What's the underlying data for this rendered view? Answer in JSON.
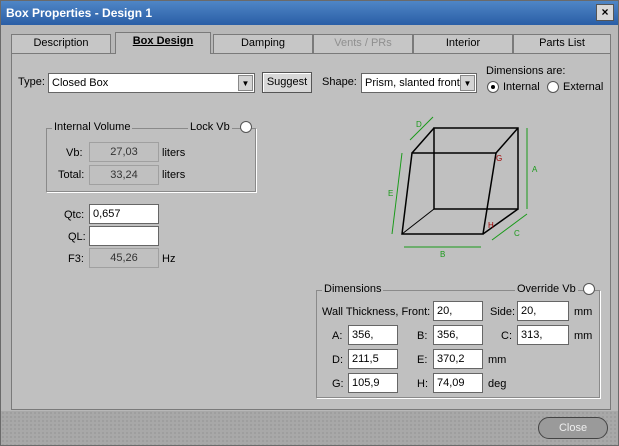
{
  "window": {
    "title": "Box Properties - Design 1"
  },
  "tabs": [
    {
      "label": "Description"
    },
    {
      "label": "Box Design"
    },
    {
      "label": "Damping"
    },
    {
      "label": "Vents / PRs"
    },
    {
      "label": "Interior"
    },
    {
      "label": "Parts List"
    }
  ],
  "type": {
    "label": "Type:",
    "value": "Closed Box",
    "suggest": "Suggest"
  },
  "shape": {
    "label": "Shape:",
    "value": "Prism, slanted front"
  },
  "dims_are": {
    "label": "Dimensions are:",
    "internal": "Internal",
    "external": "External",
    "selected": "Internal"
  },
  "internal_volume": {
    "title": "Internal Volume",
    "lock": "Lock Vb",
    "vb_label": "Vb:",
    "vb": "27,03",
    "vb_unit": "liters",
    "total_label": "Total:",
    "total": "33,24",
    "total_unit": "liters"
  },
  "params": {
    "qtc_label": "Qtc:",
    "qtc": "0,657",
    "ql_label": "QL:",
    "ql": "",
    "f3_label": "F3:",
    "f3": "45,26",
    "f3_unit": "Hz"
  },
  "diagram": {
    "labels": [
      "D",
      "A",
      "E",
      "G",
      "H",
      "C",
      "B"
    ],
    "accent": "#1a9a1a",
    "marker": "#a00000"
  },
  "dimensions": {
    "title": "Dimensions",
    "override": "Override Vb",
    "wall_label": "Wall Thickness, Front:",
    "front": "20,",
    "side_label": "Side:",
    "side": "20,",
    "unit_mm": "mm",
    "a_label": "A:",
    "a": "356,",
    "b_label": "B:",
    "b": "356,",
    "c_label": "C:",
    "c": "313,",
    "d_label": "D:",
    "d": "211,5",
    "e_label": "E:",
    "e": "370,2",
    "g_label": "G:",
    "g": "105,9",
    "h_label": "H:",
    "h": "74,09",
    "unit_deg": "deg"
  },
  "footer": {
    "close": "Close"
  }
}
